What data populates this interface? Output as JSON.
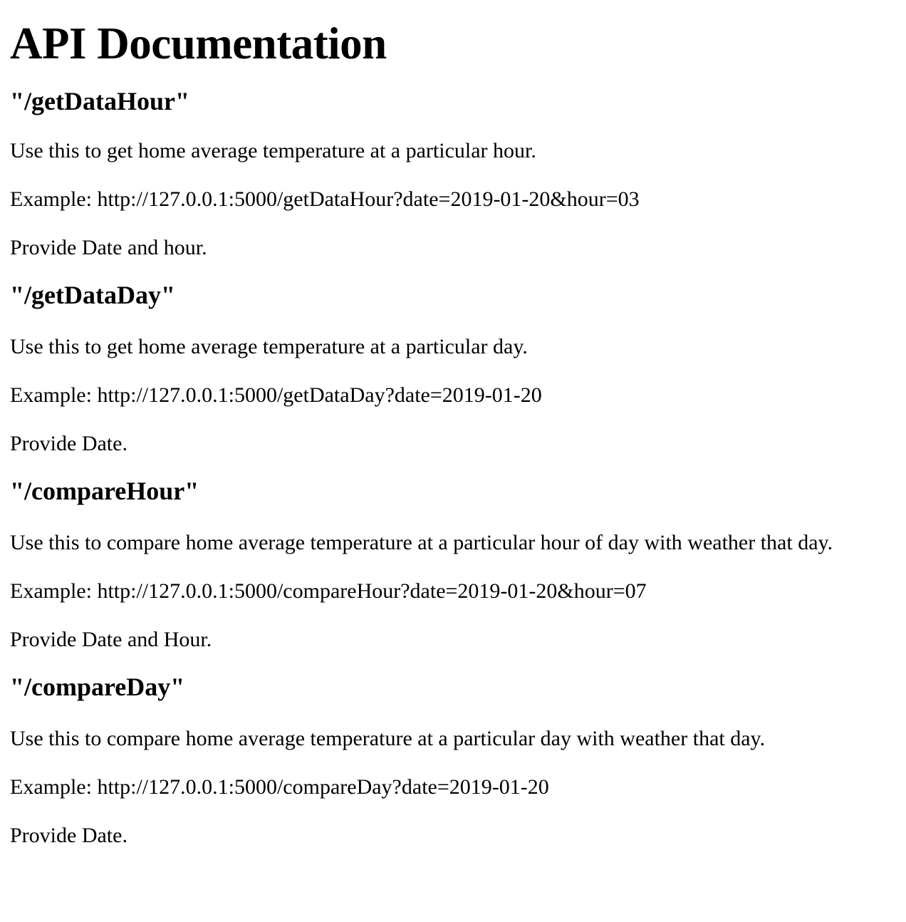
{
  "page": {
    "title": "API Documentation"
  },
  "endpoints": [
    {
      "route": "\"/getDataHour\"",
      "description": "Use this to get home average temperature at a particular hour.",
      "example": "Example: http://127.0.0.1:5000/getDataHour?date=2019-01-20&hour=03",
      "note": "Provide Date and hour."
    },
    {
      "route": "\"/getDataDay\"",
      "description": "Use this to get home average temperature at a particular day.",
      "example": "Example: http://127.0.0.1:5000/getDataDay?date=2019-01-20",
      "note": "Provide Date."
    },
    {
      "route": "\"/compareHour\"",
      "description": "Use this to compare home average temperature at a particular hour of day with weather that day.",
      "example": "Example: http://127.0.0.1:5000/compareHour?date=2019-01-20&hour=07",
      "note": "Provide Date and Hour."
    },
    {
      "route": "\"/compareDay\"",
      "description": "Use this to compare home average temperature at a particular day with weather that day.",
      "example": "Example: http://127.0.0.1:5000/compareDay?date=2019-01-20",
      "note": "Provide Date."
    }
  ]
}
